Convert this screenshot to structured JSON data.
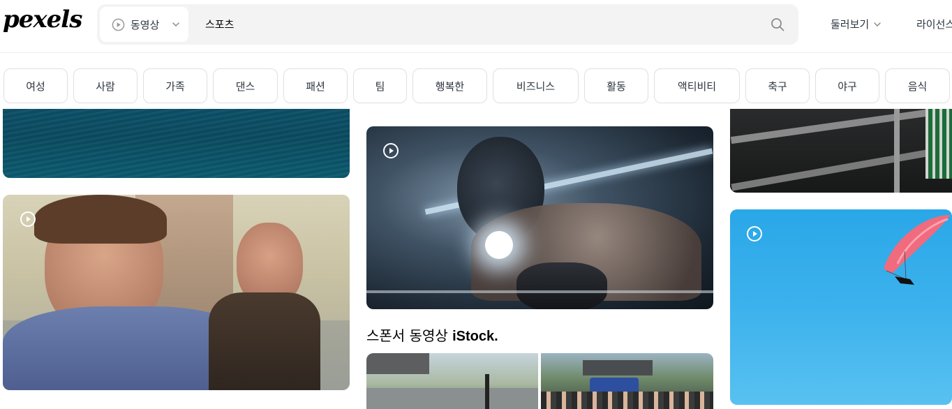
{
  "header": {
    "logo": "pexels",
    "search": {
      "type_label": "동영상",
      "query": "스포츠"
    },
    "nav": {
      "explore": "둘러보기",
      "license": "라이선스"
    }
  },
  "categories": [
    "여성",
    "사람",
    "가족",
    "댄스",
    "패션",
    "팀",
    "행복한",
    "비즈니스",
    "활동",
    "액티비티",
    "축구",
    "야구",
    "음식"
  ],
  "sponsor": {
    "text": "스폰서 동영상",
    "brand": "iStock."
  },
  "colors": {
    "accent_text": "#2c343e",
    "chip_border": "#dfdfe0",
    "search_bg": "#f3f3f3"
  },
  "icons": {
    "video_type": "play-circle-icon",
    "dropdown": "chevron-down-icon",
    "search": "search-icon"
  }
}
